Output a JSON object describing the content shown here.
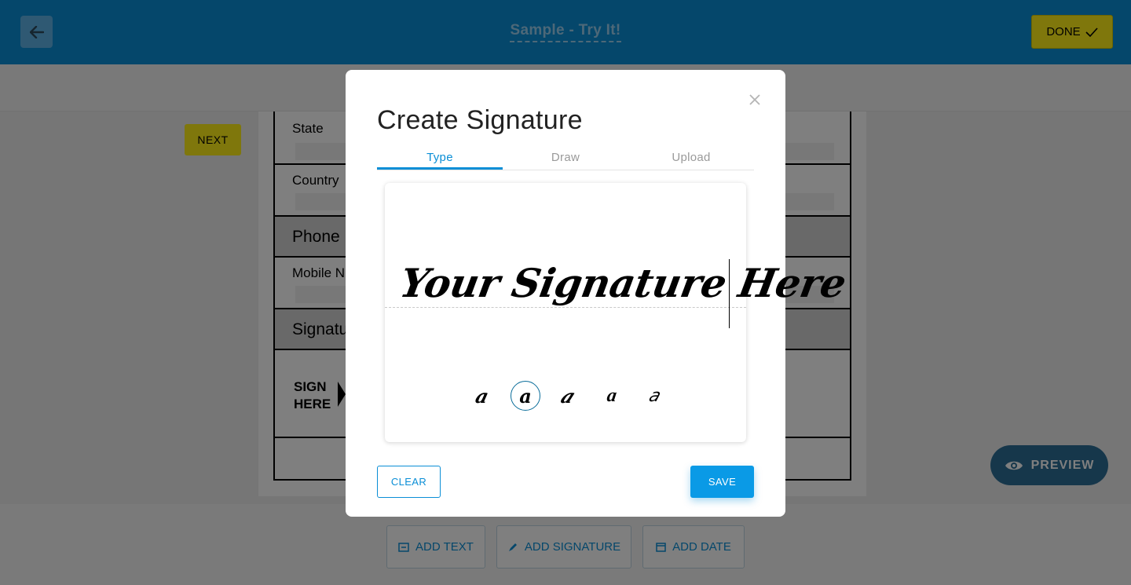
{
  "header": {
    "back_icon": "arrow-left-icon",
    "title": "Sample - Try It!",
    "done_label": "DONE",
    "done_icon": "check-icon"
  },
  "document": {
    "next_label": "NEXT",
    "rows": [
      {
        "label": "State"
      },
      {
        "label": "Country"
      },
      {
        "label": "Phone"
      },
      {
        "label": "Mobile Nu"
      },
      {
        "label": "Signatu"
      },
      {
        "label": "SIGN\nHERE"
      }
    ]
  },
  "preview": {
    "label": "PREVIEW",
    "icon": "eye-icon"
  },
  "toolbar": {
    "add_text": "ADD TEXT",
    "add_signature": "ADD SIGNATURE",
    "add_date": "ADD DATE"
  },
  "modal": {
    "title": "Create Signature",
    "close_icon": "close-icon",
    "tabs": [
      {
        "label": "Type",
        "active": true
      },
      {
        "label": "Draw",
        "active": false
      },
      {
        "label": "Upload",
        "active": false
      }
    ],
    "signature_text": "Your Signature Here",
    "font_options": [
      "a",
      "a",
      "a",
      "a",
      "a"
    ],
    "selected_font_index": 1,
    "clear_label": "CLEAR",
    "save_label": "SAVE"
  },
  "colors": {
    "primary": "#0a8ed6",
    "accent_yellow": "#ffef19",
    "preview_bg": "#2d6f96"
  }
}
